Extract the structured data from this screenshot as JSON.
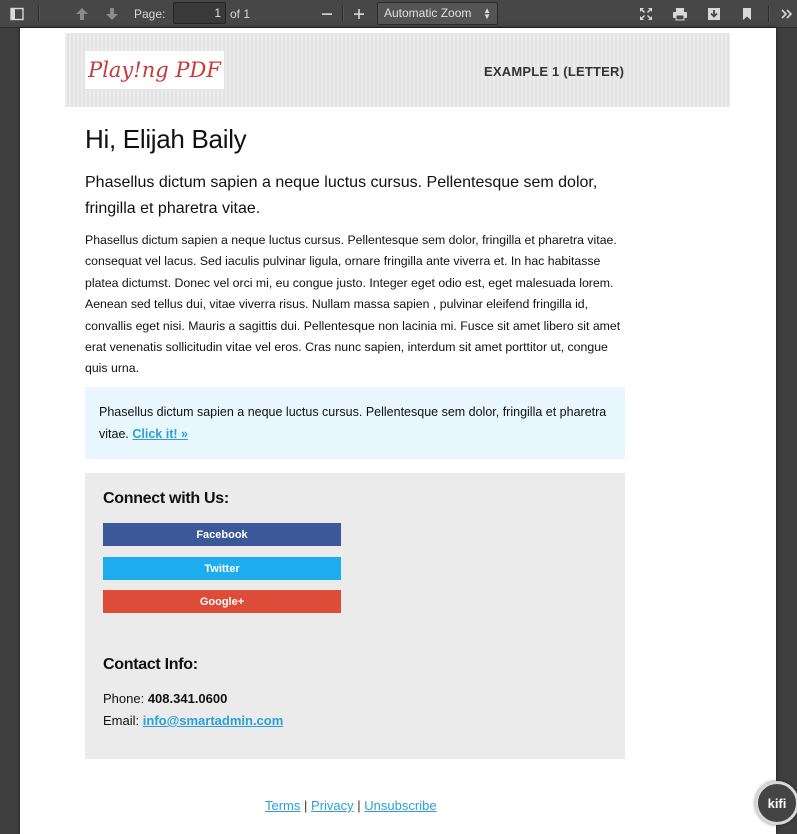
{
  "toolbar": {
    "page_label": "Page:",
    "page_value": "1",
    "page_of": "of 1",
    "zoom_value": "Automatic Zoom"
  },
  "document": {
    "logo_text": "Play!ng PDF",
    "header_title": "EXAMPLE 1 (LETTER)",
    "greeting": "Hi, Elijah Baily",
    "lead": "Phasellus dictum sapien a neque luctus cursus. Pellentesque sem dolor, fringilla et pharetra vitae.",
    "body": "Phasellus dictum sapien a neque luctus cursus. Pellentesque sem dolor, fringilla et pharetra vitae. consequat vel lacus. Sed iaculis pulvinar ligula, ornare fringilla ante viverra et. In hac habitasse platea dictumst. Donec vel orci mi, eu congue justo. Integer eget odio est, eget malesuada lorem. Aenean sed tellus dui, vitae viverra risus. Nullam massa sapien , pulvinar eleifend fringilla id, convallis eget nisi. Mauris a sagittis dui. Pellentesque non lacinia mi. Fusce sit amet libero sit amet erat venenatis sollicitudin vitae vel eros. Cras nunc sapien, interdum sit amet porttitor ut, congue quis urna.",
    "callout_text": "Phasellus dictum sapien a neque luctus cursus. Pellentesque sem dolor, fringilla et pharetra vitae.",
    "callout_link": "Click it! »",
    "connect_heading": "Connect with Us:",
    "social": [
      {
        "label": "Facebook",
        "color": "#3b5998"
      },
      {
        "label": "Twitter",
        "color": "#1daced"
      },
      {
        "label": "Google+",
        "color": "#dd4b39"
      }
    ],
    "contact_heading": "Contact Info:",
    "phone_label": "Phone:",
    "phone_value": "408.341.0600",
    "email_label": "Email:",
    "email_value": "info@smartadmin.com",
    "footer_links": [
      "Terms",
      "Privacy",
      "Unsubscribe"
    ],
    "footer_separator": "|"
  },
  "kifi_badge": "kifi"
}
